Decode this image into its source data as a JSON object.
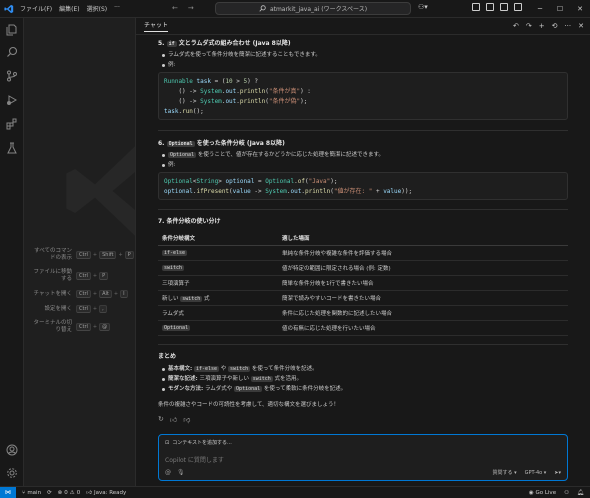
{
  "titlebar": {
    "menu": [
      "ファイル(F)",
      "編集(E)",
      "選択(S)",
      "···"
    ],
    "search_text": "atmarkit_java_ai (ワークスペース)"
  },
  "shortcuts": [
    {
      "label": "すべてのコマンドの表示",
      "keys": [
        "Ctrl",
        "Shift",
        "P"
      ]
    },
    {
      "label": "ファイルに移動する",
      "keys": [
        "Ctrl",
        "P"
      ]
    },
    {
      "label": "チャットを開く",
      "keys": [
        "Ctrl",
        "Alt",
        "I"
      ]
    },
    {
      "label": "設定を開く",
      "keys": [
        "Ctrl",
        ","
      ]
    },
    {
      "label": "ターミナルの切り替え",
      "keys": [
        "Ctrl",
        "@"
      ]
    }
  ],
  "chat": {
    "tab_label": "チャット",
    "section5": {
      "num": "5.",
      "code_label": "if",
      "title_rest": "文とラムダ式の組み合わせ (Java 8以降)",
      "bullet1": "ラムダ式を使って条件分岐を簡潔に記述することもできます。",
      "bullet2": "例:",
      "code": [
        "Runnable task = (10 > 5) ?",
        "    () -> System.out.println(\"条件が真\") :",
        "    () -> System.out.println(\"条件が偽\");",
        "task.run();"
      ]
    },
    "section6": {
      "num": "6.",
      "code_label": "Optional",
      "title_rest": "を使った条件分岐 (Java 8以降)",
      "bullet1_code": "Optional",
      "bullet1_text": "を使うことで、値が存在するかどうかに応じた処理を簡潔に記述できます。",
      "bullet2": "例:",
      "code": [
        "Optional<String> optional = Optional.of(\"Java\");",
        "optional.ifPresent(value -> System.out.println(\"値が存在: \" + value));"
      ]
    },
    "section7": {
      "title": "7. 条件分岐の使い分け",
      "headers": [
        "条件分岐構文",
        "適した場面"
      ],
      "rows": [
        {
          "syntax": "if-else",
          "is_code": true,
          "scene": "単純な条件分岐や複雑な条件を評価する場合"
        },
        {
          "syntax": "switch",
          "is_code": true,
          "scene": "値が特定の範囲に限定される場合 (例: 定数)"
        },
        {
          "syntax": "三項演算子",
          "is_code": false,
          "scene": "簡単な条件分岐を1行で書きたい場合"
        },
        {
          "syntax": "新しい switch 式",
          "is_code": false,
          "scene": "簡潔で読みやすいコードを書きたい場合"
        },
        {
          "syntax": "ラムダ式",
          "is_code": false,
          "scene": "条件に応じた処理を関数的に記述したい場合"
        },
        {
          "syntax": "Optional",
          "is_code": true,
          "scene": "値の有無に応じた処理を行いたい場合"
        }
      ]
    },
    "summary": {
      "title": "まとめ",
      "b1_label": "基本構文:",
      "b1_code1": "if-else",
      "b1_mid": "や",
      "b1_code2": "switch",
      "b1_rest": "を使って条件分岐を記述。",
      "b2_label": "簡潔な記述:",
      "b2_text1": "三項演算子や新しい",
      "b2_code": "switch",
      "b2_text2": "式を活用。",
      "b3_label": "モダンな方法:",
      "b3_text1": "ラムダ式や",
      "b3_code": "Optional",
      "b3_text2": "を使って柔軟に条件分岐を記述。",
      "closing": "条件の複雑さやコードの可読性を考慮して、適切な構文を選びましょう！"
    },
    "input": {
      "context_button": "コンテキストを追加する...",
      "placeholder": "Copilot に質問します",
      "mode": "質問する",
      "model": "GPT-4o"
    }
  },
  "statusbar": {
    "branch": "main",
    "errors": "0",
    "warnings": "0",
    "java": "Java: Ready",
    "golive": "Go Live"
  },
  "colors": {
    "accent": "#0078d4",
    "background": "#1f1f1f",
    "panel": "#181818"
  }
}
